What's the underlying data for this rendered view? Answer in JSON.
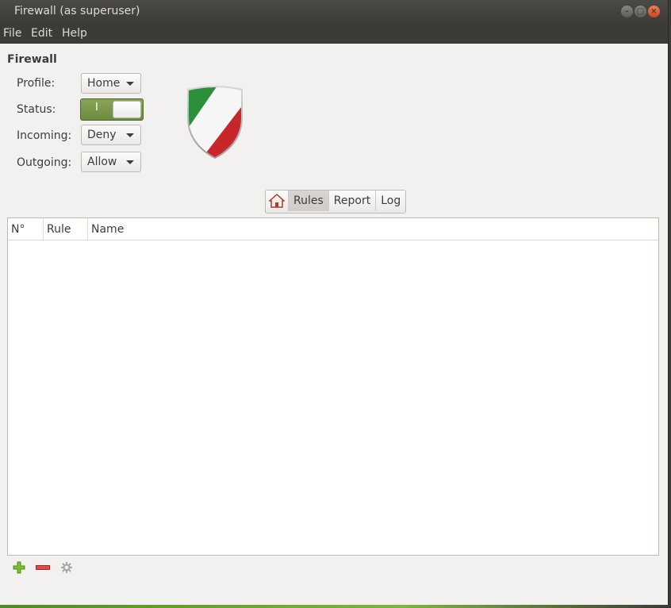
{
  "window": {
    "title": "Firewall (as superuser)",
    "controls": {
      "minimize": "–",
      "maximize": "□",
      "close": "×"
    }
  },
  "menu": [
    "File",
    "Edit",
    "Help"
  ],
  "firewall": {
    "section_title": "Firewall",
    "profile": {
      "label": "Profile:",
      "value": "Home"
    },
    "status": {
      "label": "Status:",
      "toggle_text": "I",
      "state": "on"
    },
    "incoming": {
      "label": "Incoming:",
      "value": "Deny"
    },
    "outgoing": {
      "label": "Outgoing:",
      "value": "Allow"
    }
  },
  "tabs": {
    "home_icon": "home-icon",
    "items": [
      "Rules",
      "Report",
      "Log"
    ],
    "active": "Rules"
  },
  "rules_table": {
    "columns": [
      "N°",
      "Rule",
      "Name"
    ],
    "rows": []
  },
  "toolbar": {
    "icons": [
      "add-icon",
      "remove-icon",
      "gear-icon"
    ]
  },
  "colors": {
    "titlebar": "#3c3b37",
    "window_bg": "#f2f1f0",
    "switch_on": "#7a9a48",
    "close_button": "#e9642c",
    "add_icon": "#6eb520",
    "remove_icon": "#d73b3b"
  }
}
